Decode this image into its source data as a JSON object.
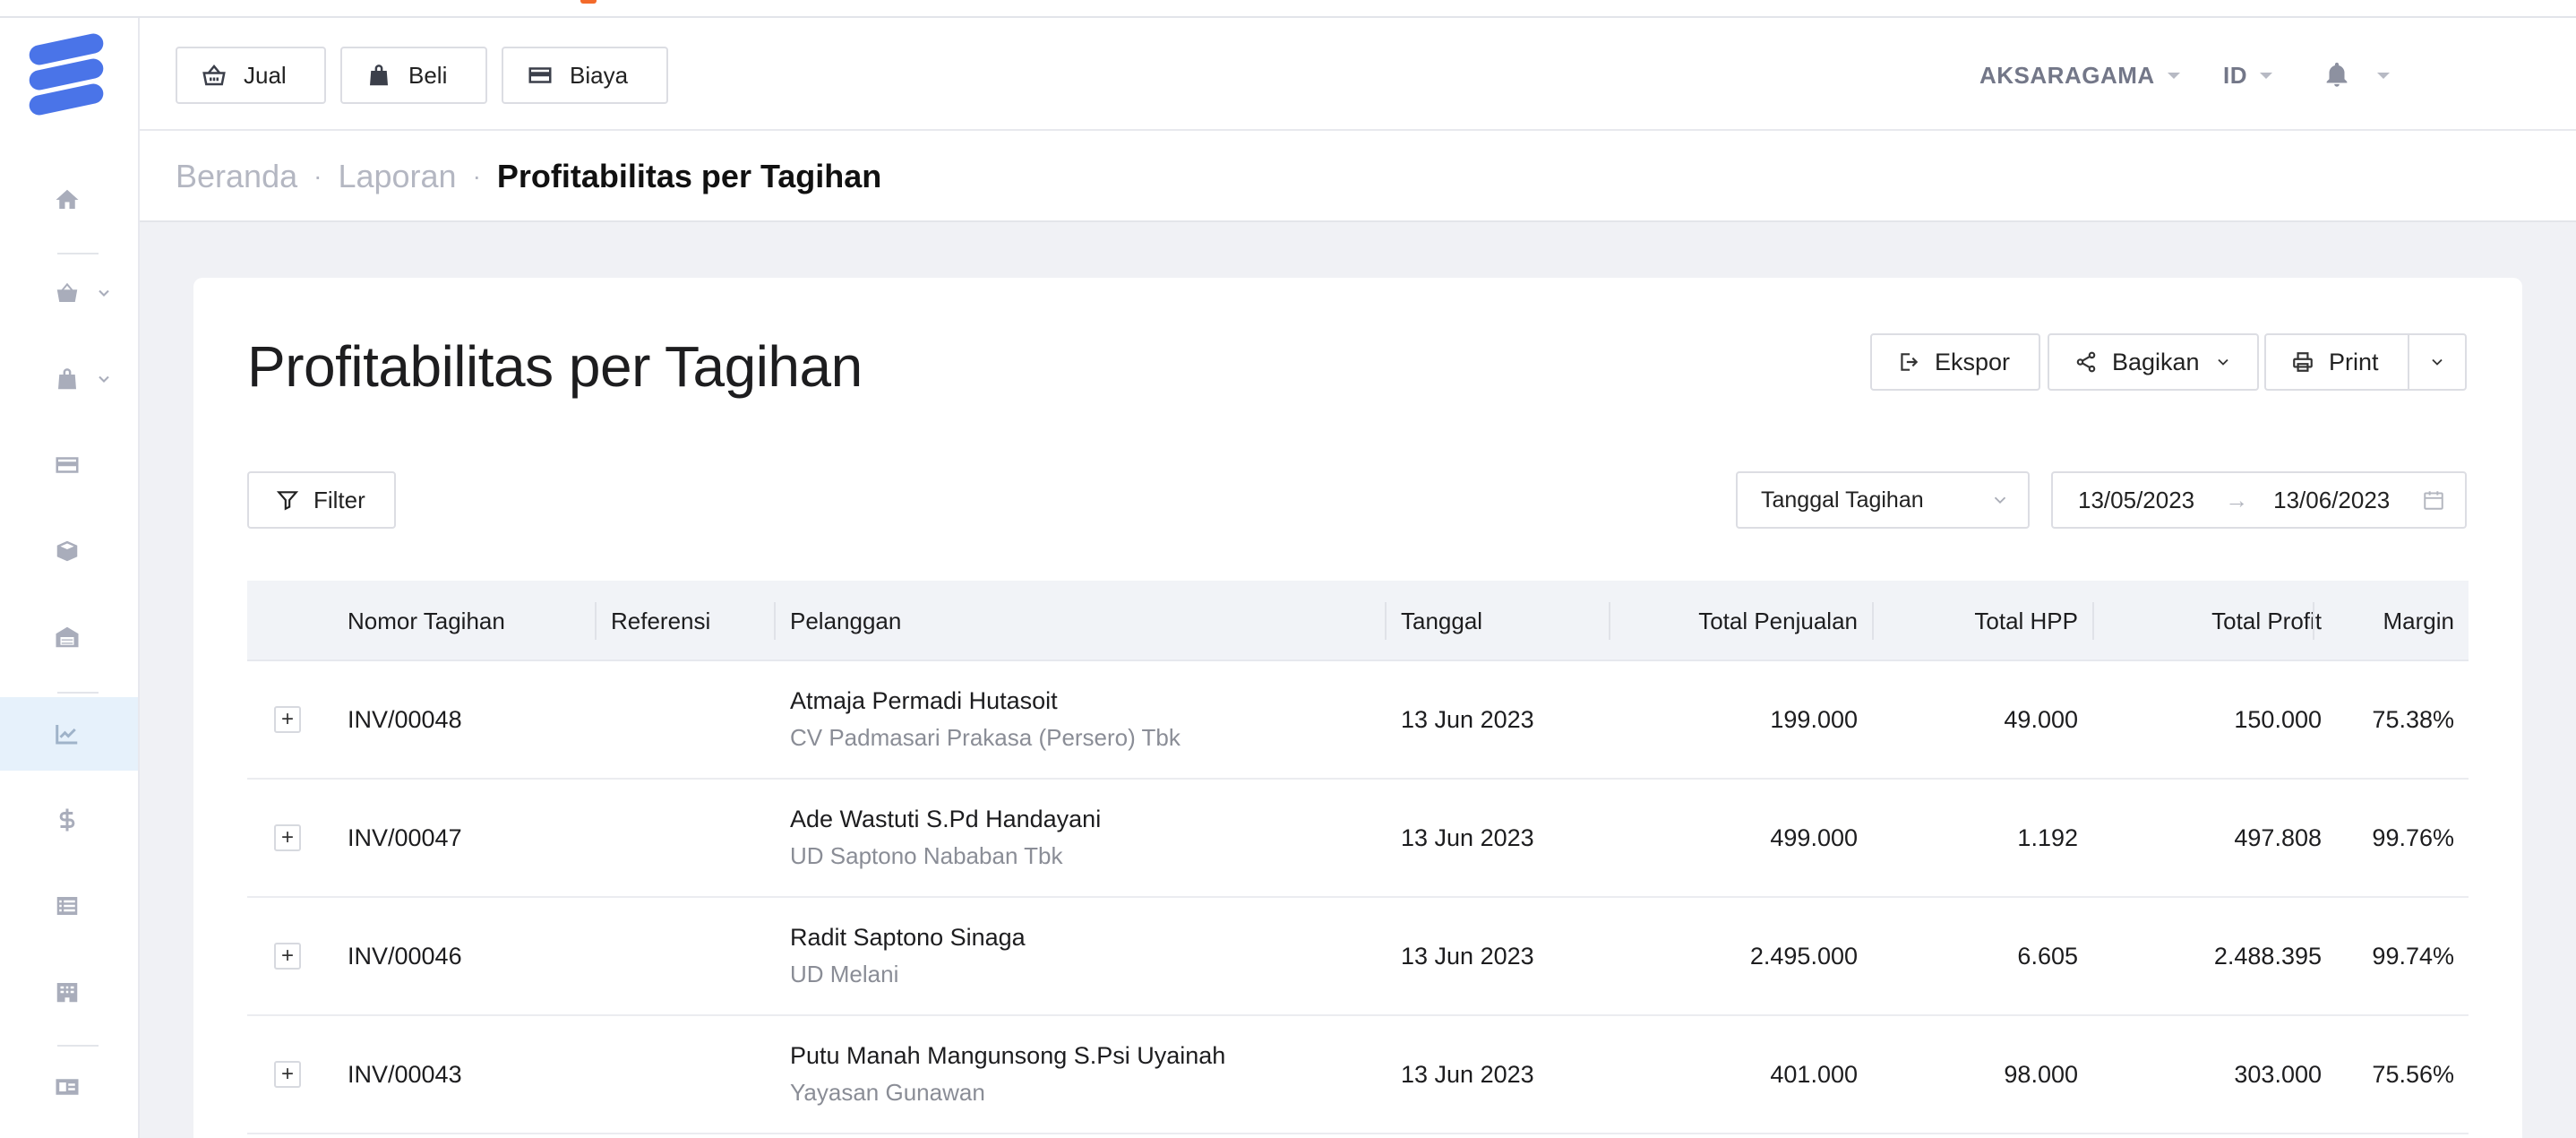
{
  "header": {
    "quick_buttons": [
      {
        "label": "Jual",
        "icon": "basket-icon"
      },
      {
        "label": "Beli",
        "icon": "bag-icon"
      },
      {
        "label": "Biaya",
        "icon": "card-icon"
      }
    ],
    "company": "AKSARAGAMA",
    "language": "ID",
    "notification_icon": "bell-icon"
  },
  "sidebar": {
    "items": [
      {
        "name": "home",
        "icon": "home-icon"
      },
      {
        "name": "sales",
        "icon": "basket-icon"
      },
      {
        "name": "purchases",
        "icon": "bag-icon"
      },
      {
        "name": "expenses",
        "icon": "card-icon"
      },
      {
        "name": "products",
        "icon": "box-icon"
      },
      {
        "name": "assets",
        "icon": "warehouse-icon"
      },
      {
        "name": "reports",
        "icon": "chart-icon",
        "active": true
      },
      {
        "name": "cash-bank",
        "icon": "dollar-icon"
      },
      {
        "name": "accounts",
        "icon": "list-icon"
      },
      {
        "name": "company",
        "icon": "building-icon"
      },
      {
        "name": "contacts",
        "icon": "id-card-icon"
      }
    ]
  },
  "breadcrumb": {
    "items": [
      "Beranda",
      "Laporan"
    ],
    "current": "Profitabilitas per Tagihan"
  },
  "page": {
    "title": "Profitabilitas per Tagihan",
    "actions": {
      "export": "Ekspor",
      "share": "Bagikan",
      "print": "Print"
    },
    "filter_label": "Filter",
    "date_type": "Tanggal Tagihan",
    "date_from": "13/05/2023",
    "date_to": "13/06/2023"
  },
  "table": {
    "columns": {
      "invoice": "Nomor Tagihan",
      "reference": "Referensi",
      "customer": "Pelanggan",
      "date": "Tanggal",
      "total_sales": "Total Penjualan",
      "total_cogs": "Total HPP",
      "total_profit": "Total Profit",
      "margin": "Margin"
    },
    "rows": [
      {
        "invoice": "INV/00048",
        "reference": "",
        "customer": "Atmaja Permadi Hutasoit",
        "company": "CV Padmasari Prakasa (Persero) Tbk",
        "date": "13 Jun 2023",
        "total_sales": "199.000",
        "total_cogs": "49.000",
        "total_profit": "150.000",
        "margin": "75.38%"
      },
      {
        "invoice": "INV/00047",
        "reference": "",
        "customer": "Ade Wastuti S.Pd Handayani",
        "company": "UD Saptono Nababan Tbk",
        "date": "13 Jun 2023",
        "total_sales": "499.000",
        "total_cogs": "1.192",
        "total_profit": "497.808",
        "margin": "99.76%"
      },
      {
        "invoice": "INV/00046",
        "reference": "",
        "customer": "Radit Saptono Sinaga",
        "company": "UD Melani",
        "date": "13 Jun 2023",
        "total_sales": "2.495.000",
        "total_cogs": "6.605",
        "total_profit": "2.488.395",
        "margin": "99.74%"
      },
      {
        "invoice": "INV/00043",
        "reference": "",
        "customer": "Putu Manah Mangunsong S.Psi Uyainah",
        "company": "Yayasan Gunawan",
        "date": "13 Jun 2023",
        "total_sales": "401.000",
        "total_cogs": "98.000",
        "total_profit": "303.000",
        "margin": "75.56%"
      }
    ]
  },
  "colors": {
    "brand": "#4a74e8",
    "active_nav_bg": "#e6f1fb",
    "page_bg": "#f0f1f5",
    "accent_top": "#f36a2b"
  }
}
